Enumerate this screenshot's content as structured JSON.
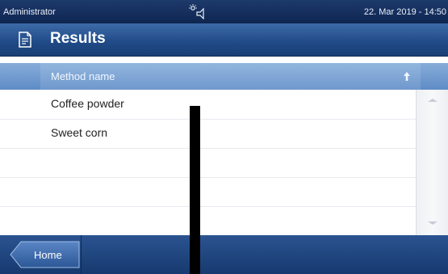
{
  "status_bar": {
    "user": "Administrator",
    "connection_icon": "connection-speaker-icon",
    "datetime": "22. Mar 2019 - 14:50"
  },
  "title_bar": {
    "icon": "results-document-icon",
    "title": "Results"
  },
  "table": {
    "column_header": "Method name",
    "sort_icon": "sort-ascending-arrow-icon",
    "rows": [
      "Coffee powder",
      "Sweet corn"
    ]
  },
  "footer": {
    "home_label": "Home"
  },
  "colors": {
    "status_bar": "#0f2550",
    "title_bar": "#1f4a86",
    "column_header": "#6f98cd",
    "footer": "#1f4680"
  }
}
